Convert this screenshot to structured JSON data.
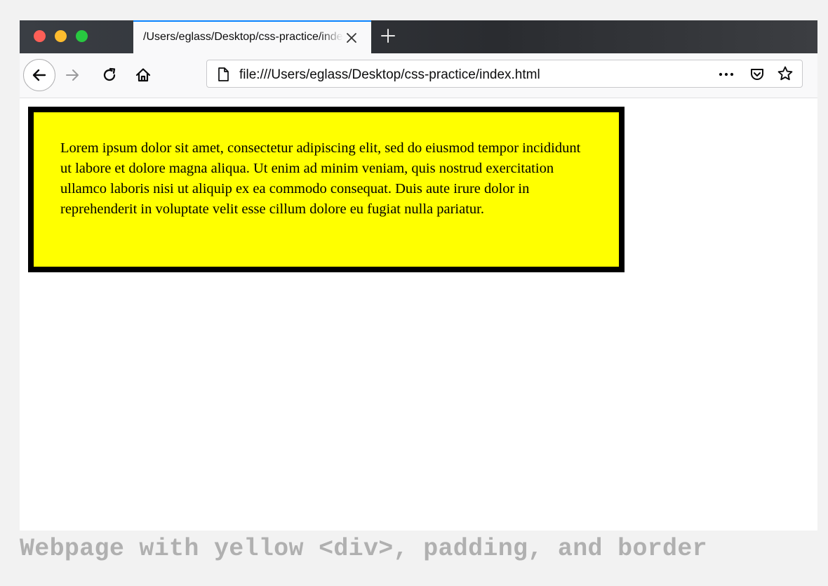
{
  "browser": {
    "tab": {
      "title": "/Users/eglass/Desktop/css-practice/index.html"
    },
    "url": "file:///Users/eglass/Desktop/css-practice/index.html",
    "icons": [
      "back-arrow-icon",
      "forward-arrow-icon",
      "reload-icon",
      "home-icon",
      "page-icon",
      "more-dots-icon",
      "pocket-icon",
      "star-icon",
      "close-icon",
      "plus-icon"
    ]
  },
  "page": {
    "box_text": "Lorem ipsum dolor sit amet, consectetur adipiscing elit, sed do eiusmod tempor incididunt ut labore et dolore magna aliqua. Ut enim ad minim veniam, quis nostrud exercitation ullamco laboris nisi ut aliquip ex ea commodo consequat. Duis aute irure dolor in reprehenderit in voluptate velit esse cillum dolore eu fugiat nulla pariatur.",
    "box_color": "#ffff00",
    "border_color": "#000000"
  },
  "caption": "Webpage with yellow <div>, padding, and border",
  "colors": {
    "tab_accent": "#0a84ff",
    "caption": "#b0b0b0"
  }
}
